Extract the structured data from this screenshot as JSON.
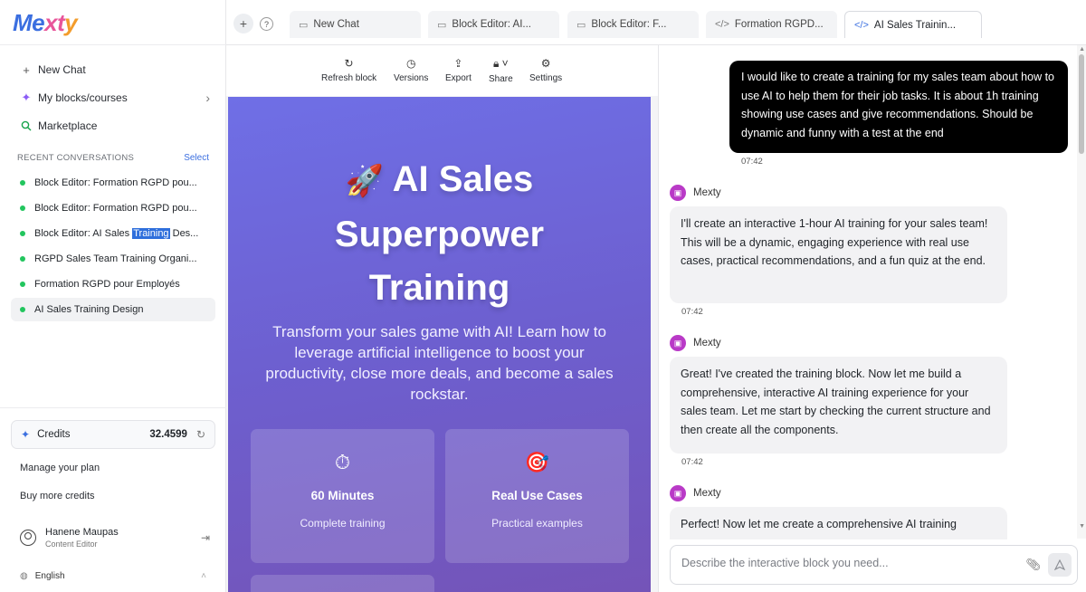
{
  "app": {
    "logo": "Mexty"
  },
  "sidebar": {
    "nav": [
      {
        "label": "New Chat",
        "icon": "plus-icon"
      },
      {
        "label": "My blocks/courses",
        "icon": "sparkle-icon"
      },
      {
        "label": "Marketplace",
        "icon": "search-icon"
      }
    ],
    "recent_label": "RECENT CONVERSATIONS",
    "select_label": "Select",
    "conversations": [
      {
        "pre": "Block Editor: Formation RGPD pou...",
        "hl": "",
        "post": ""
      },
      {
        "pre": "Block Editor: Formation RGPD pou...",
        "hl": "",
        "post": ""
      },
      {
        "pre": "Block Editor: AI Sales ",
        "hl": "Training",
        "post": " Des..."
      },
      {
        "pre": "RGPD Sales Team Training Organi...",
        "hl": "",
        "post": ""
      },
      {
        "pre": "Formation RGPD pour Employés",
        "hl": "",
        "post": ""
      },
      {
        "pre": "AI Sales Training Design",
        "hl": "",
        "post": ""
      }
    ],
    "credits_label": "Credits",
    "credits_value": "32.4599",
    "manage_plan": "Manage your plan",
    "buy_credits": "Buy more credits",
    "user_name": "Hanene Maupas",
    "user_role": "Content Editor",
    "language": "English"
  },
  "tabs": [
    {
      "label": "New Chat",
      "icon": "chat-icon"
    },
    {
      "label": "Block Editor: AI...",
      "icon": "chat-icon"
    },
    {
      "label": "Block Editor: F...",
      "icon": "chat-icon"
    },
    {
      "label": "Formation RGPD...",
      "icon": "code-icon"
    },
    {
      "label": "AI Sales Trainin...",
      "icon": "code-icon"
    }
  ],
  "toolbar": {
    "refresh": "Refresh block",
    "versions": "Versions",
    "export": "Export",
    "share": "Share",
    "settings": "Settings"
  },
  "preview": {
    "title_line1": "AI Sales",
    "title_line2": "Superpower",
    "title_line3": "Training",
    "subtitle": "Transform your sales game with AI! Learn how to leverage artificial intelligence to boost your productivity, close more deals, and become a sales rockstar.",
    "cards": [
      {
        "icon": "⏱",
        "title": "60 Minutes",
        "desc": "Complete training"
      },
      {
        "icon": "🎯",
        "title": "Real Use Cases",
        "desc": "Practical examples"
      }
    ],
    "accent_gradient": [
      "#6f6fe6",
      "#7454b8"
    ]
  },
  "chat": {
    "user_message": "I would like to create a training for my sales team about how to use AI to help them for their job tasks. It is about 1h training showing use cases and give recommendations. Should be dynamic and funny with a test at the end",
    "user_time": "07:42",
    "bot_name": "Mexty",
    "bot_messages": [
      {
        "text": "I'll create an interactive 1-hour AI training for your sales team! This will be a dynamic, engaging experience with real use cases, practical recommendations, and a fun quiz at the end.",
        "time": "07:42"
      },
      {
        "text": "Great! I've created the training block. Now let me build a comprehensive, interactive AI training experience for your sales team. Let me start by checking the current structure and then create all the components.",
        "time": "07:42"
      },
      {
        "text": "Perfect! Now let me create a comprehensive AI training",
        "time": ""
      }
    ],
    "input_placeholder": "Describe the interactive block you need..."
  }
}
